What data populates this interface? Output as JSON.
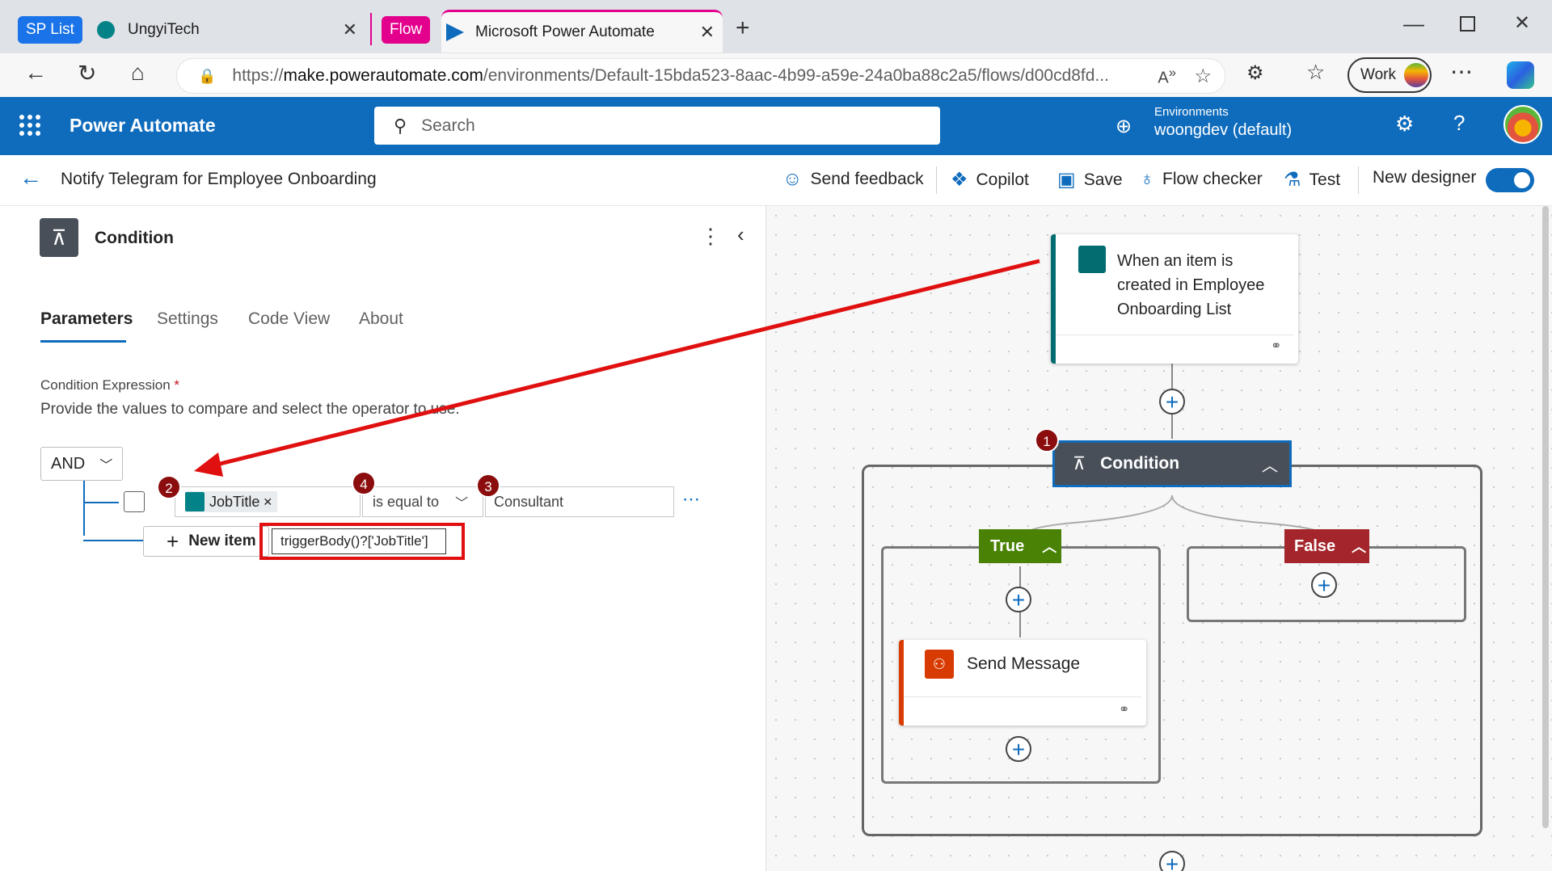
{
  "browser": {
    "tabs": [
      {
        "group": "SP List",
        "group_color": "#1a73e8",
        "title": "UngyiTech"
      },
      {
        "group": "Flow",
        "group_color": "#e3008c",
        "title": "Microsoft Power Automate"
      }
    ],
    "url_prefix": "https://",
    "url_host": "make.powerautomate.com",
    "url_path": "/environments/Default-15bda523-8aac-4b99-a59e-24a0ba88c2a5/flows/d00cd8fd...",
    "profile_label": "Work"
  },
  "header": {
    "app_name": "Power Automate",
    "search_placeholder": "Search",
    "env_label": "Environments",
    "env_value": "woongdev (default)",
    "accent": "#0f6cbd"
  },
  "commandbar": {
    "flow_name": "Notify Telegram for Employee Onboarding",
    "send_feedback": "Send feedback",
    "copilot": "Copilot",
    "save": "Save",
    "flow_checker": "Flow checker",
    "test": "Test",
    "new_designer": "New designer",
    "new_designer_on": true
  },
  "panel": {
    "title": "Condition",
    "tabs": [
      "Parameters",
      "Settings",
      "Code View",
      "About"
    ],
    "active_tab": "Parameters",
    "expr_label": "Condition Expression",
    "expr_required": "*",
    "expr_desc": "Provide the values to compare and select the operator to use.",
    "group_operator": "AND",
    "row": {
      "token": "JobTitle",
      "operator": "is equal to",
      "value": "Consultant"
    },
    "new_item": "New item",
    "tooltip": "triggerBody()?['JobTitle']"
  },
  "annotations": [
    "1",
    "2",
    "3",
    "4"
  ],
  "canvas": {
    "trigger": "When an item is created in Employee Onboarding List",
    "condition": "Condition",
    "true_label": "True",
    "false_label": "False",
    "action": "Send Message",
    "true_color": "#498205",
    "false_color": "#a4262c"
  }
}
